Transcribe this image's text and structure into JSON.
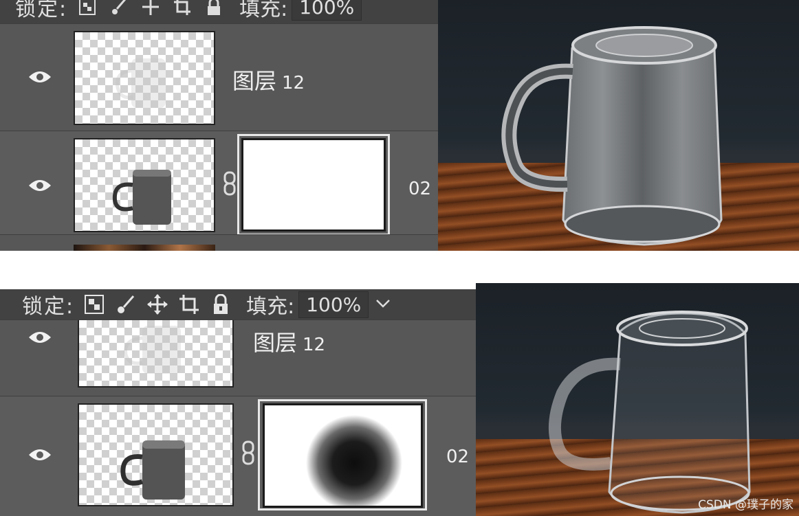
{
  "top": {
    "lockbar": {
      "lock_label": "锁定:",
      "fill_label": "填充:",
      "fill_value": "100%"
    },
    "layers": [
      {
        "name": "图层",
        "number": "12"
      },
      {
        "name": "",
        "number": "02"
      }
    ]
  },
  "bottom": {
    "lockbar": {
      "lock_label": "锁定:",
      "fill_label": "填充:",
      "fill_value": "100%"
    },
    "layers": [
      {
        "name": "图层",
        "number": "12"
      },
      {
        "name": "",
        "number": "02"
      }
    ]
  },
  "watermark": "CSDN @璞子的家",
  "colors": {
    "panel_bg": "#535353",
    "lockbar_bg": "#424242",
    "mask_white": "#ffffff",
    "mask_black": "#111111"
  },
  "icons": [
    "eye-icon",
    "link-icon",
    "checker-lock-icon",
    "brush-icon",
    "move-icon",
    "crop-icon",
    "padlock-icon"
  ]
}
